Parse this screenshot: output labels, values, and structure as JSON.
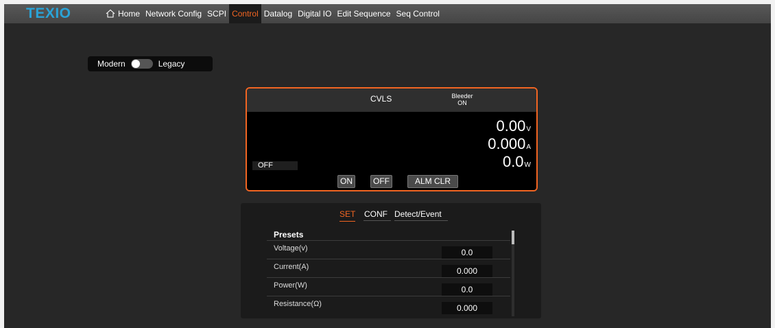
{
  "brand": {
    "logo": "TEXIO",
    "color": "#2aa3d7"
  },
  "nav": {
    "items": [
      {
        "label": "Home",
        "icon": "home-icon"
      },
      {
        "label": "Network Config"
      },
      {
        "label": "SCPI"
      },
      {
        "label": "Control",
        "active": true
      },
      {
        "label": "Datalog"
      },
      {
        "label": "Digital IO"
      },
      {
        "label": "Edit Sequence"
      },
      {
        "label": "Seq Control"
      }
    ]
  },
  "mode_toggle": {
    "left_label": "Modern",
    "right_label": "Legacy",
    "selected": "Modern"
  },
  "display": {
    "mode": "CVLS",
    "bleeder_label": "Bleeder",
    "bleeder_state": "ON",
    "voltage": "0.00",
    "voltage_unit": "V",
    "current": "0.000",
    "current_unit": "A",
    "power": "0.0",
    "power_unit": "W",
    "output_status": "OFF",
    "buttons": {
      "on": "ON",
      "off": "OFF",
      "alarm_clear": "ALM CLR"
    },
    "accent": "#f26522"
  },
  "settings": {
    "tabs": [
      {
        "label": "SET",
        "active": true
      },
      {
        "label": "CONF"
      },
      {
        "label": "Detect/Event"
      }
    ],
    "section_title": "Presets",
    "rows": [
      {
        "label": "Voltage(v)",
        "value": "0.0"
      },
      {
        "label": "Current(A)",
        "value": "0.000"
      },
      {
        "label": "Power(W)",
        "value": "0.0"
      },
      {
        "label": "Resistance(Ω)",
        "value": "0.000"
      }
    ]
  }
}
